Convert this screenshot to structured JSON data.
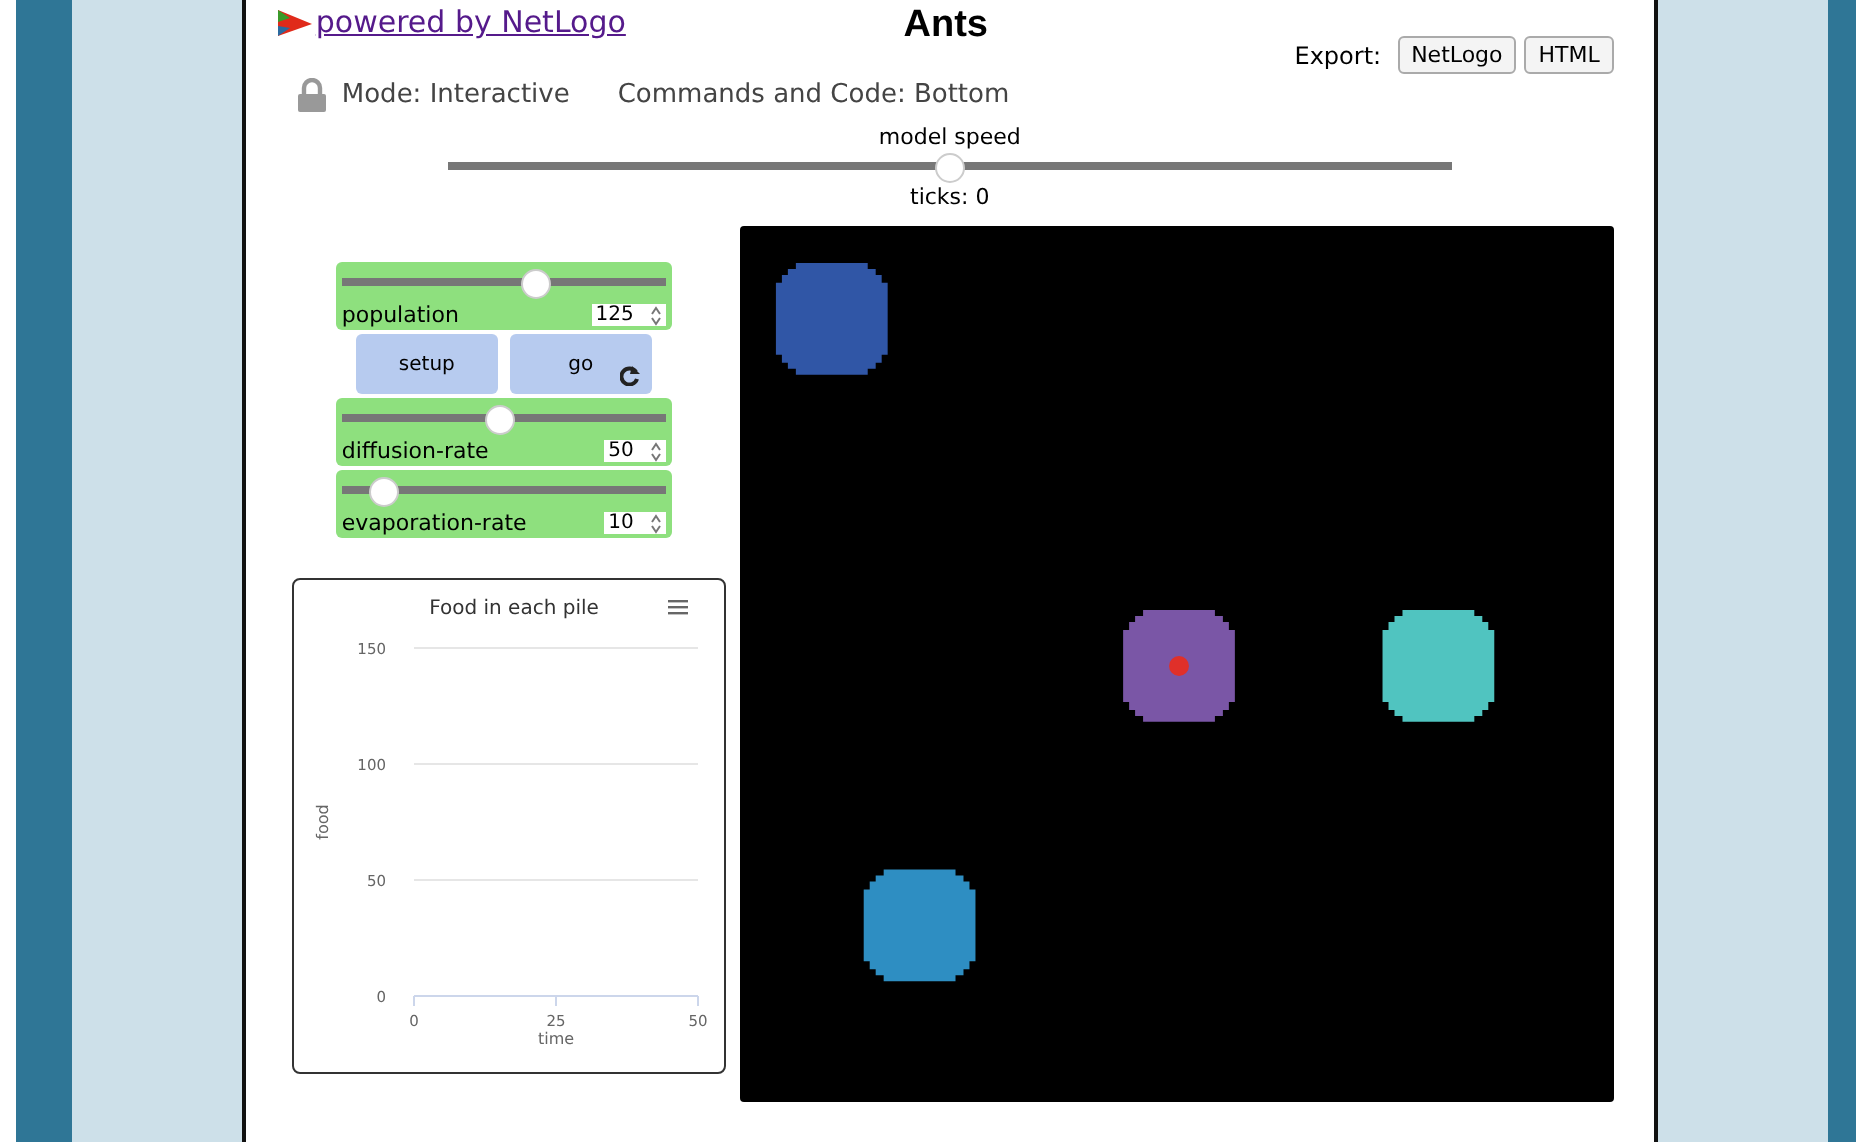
{
  "header": {
    "link": "powered by NetLogo",
    "title": "Ants",
    "export_label": "Export:",
    "export_buttons": [
      "NetLogo",
      "HTML"
    ]
  },
  "mode_bar": {
    "locked": true,
    "mode": "Mode: Interactive",
    "layout": "Commands and Code: Bottom"
  },
  "speed": {
    "label": "model speed",
    "level": 0.5,
    "ticks": "ticks: 0"
  },
  "widgets": [
    {
      "kind": "slider",
      "label": "population",
      "value": "125",
      "level": 0.6
    },
    {
      "kind": "buttons",
      "buttons": [
        {
          "label": "setup",
          "forever": false
        },
        {
          "label": "go",
          "forever": true
        }
      ]
    },
    {
      "kind": "slider",
      "label": "diffusion-rate",
      "value": "50",
      "level": 0.49
    },
    {
      "kind": "slider",
      "label": "evaporation-rate",
      "value": "10",
      "level": 0.13
    }
  ],
  "plot": {
    "chart_data": {
      "type": "line",
      "title": "Food in each pile",
      "xlabel": "time",
      "ylabel": "food",
      "xlim": [
        0,
        50
      ],
      "ylim": [
        0,
        150
      ],
      "xticks": [
        0,
        25,
        50
      ],
      "yticks": [
        0,
        50,
        100,
        150
      ]
    }
  }
}
